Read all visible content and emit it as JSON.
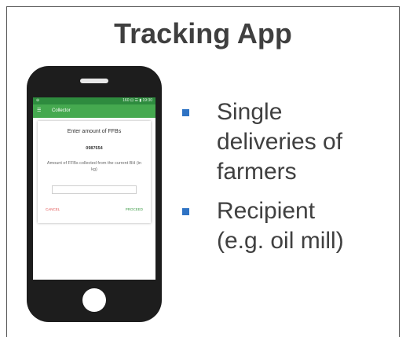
{
  "slide": {
    "title": "Tracking App",
    "bullets": [
      {
        "lines": [
          "Single",
          "deliveries of",
          "farmers"
        ]
      },
      {
        "lines": [
          "Recipient",
          "(e.g. oil mill)"
        ]
      }
    ],
    "bullet_color": "#2f73c4"
  },
  "phone": {
    "status_bar": {
      "left": "⊖",
      "right": "160 ⊡ ☰ ▮ 19:30"
    },
    "app_bar": {
      "title": "Collector",
      "menu_icon": "menu-icon"
    },
    "dialog": {
      "title": "Enter amount of FFBs",
      "id": "0987654",
      "description": "Amount of FFBs collected from the current BH (in kg)",
      "input_value": "",
      "cancel_label": "CANCEL",
      "proceed_label": "PROCEED"
    },
    "colors": {
      "status_bar": "#2e8b3e",
      "app_bar": "#45a94f",
      "cancel": "#e05050",
      "proceed": "#3c9a46"
    }
  }
}
